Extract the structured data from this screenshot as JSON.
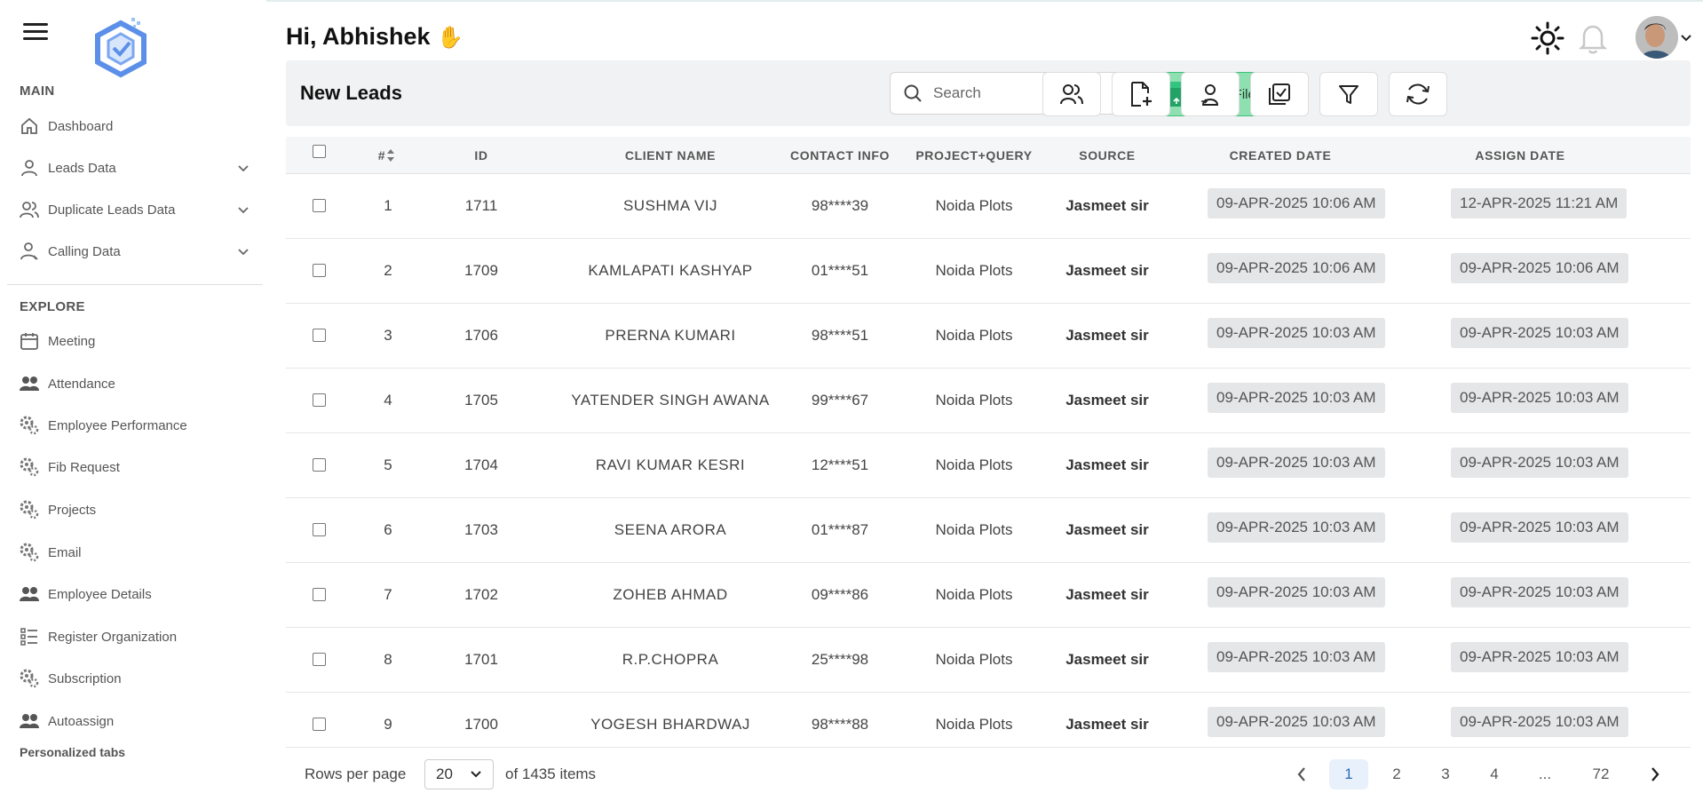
{
  "sidebar": {
    "main_title": "MAIN",
    "main_items": [
      {
        "label": "Dashboard"
      },
      {
        "label": "Leads Data"
      },
      {
        "label": "Duplicate Leads Data"
      },
      {
        "label": "Calling Data"
      }
    ],
    "explore_title": "EXPLORE",
    "explore_items": [
      {
        "label": "Meeting"
      },
      {
        "label": "Attendance"
      },
      {
        "label": "Employee Performance"
      },
      {
        "label": "Fib Request"
      },
      {
        "label": "Projects"
      },
      {
        "label": "Email"
      },
      {
        "label": "Employee Details"
      },
      {
        "label": "Register Organization"
      },
      {
        "label": "Subscription"
      },
      {
        "label": "Autoassign"
      }
    ],
    "personalized": "Personalized tabs"
  },
  "header": {
    "greeting": "Hi, Abhishek",
    "greeting_emoji": "✋"
  },
  "toolbar": {
    "title": "New Leads",
    "search_placeholder": "Search",
    "import_label": "Import File",
    "import_icon": "excel-icon"
  },
  "table": {
    "columns": [
      "#",
      "ID",
      "CLIENT NAME",
      "CONTACT INFO",
      "PROJECT+QUERY",
      "SOURCE",
      "CREATED DATE",
      "ASSIGN DATE"
    ],
    "rows": [
      {
        "n": "1",
        "id": "1711",
        "name": "SUSHMA VIJ",
        "contact": "98****39",
        "project": "Noida Plots",
        "source": "Jasmeet sir",
        "created": "09-APR-2025 10:06 AM",
        "assigned": "12-APR-2025 11:21 AM"
      },
      {
        "n": "2",
        "id": "1709",
        "name": "KAMLAPATI KASHYAP",
        "contact": "01****51",
        "project": "Noida Plots",
        "source": "Jasmeet sir",
        "created": "09-APR-2025 10:06 AM",
        "assigned": "09-APR-2025 10:06 AM"
      },
      {
        "n": "3",
        "id": "1706",
        "name": "PRERNA KUMARI",
        "contact": "98****51",
        "project": "Noida Plots",
        "source": "Jasmeet sir",
        "created": "09-APR-2025 10:03 AM",
        "assigned": "09-APR-2025 10:03 AM"
      },
      {
        "n": "4",
        "id": "1705",
        "name": "YATENDER SINGH AWANA",
        "contact": "99****67",
        "project": "Noida Plots",
        "source": "Jasmeet sir",
        "created": "09-APR-2025 10:03 AM",
        "assigned": "09-APR-2025 10:03 AM"
      },
      {
        "n": "5",
        "id": "1704",
        "name": "RAVI KUMAR KESRI",
        "contact": "12****51",
        "project": "Noida Plots",
        "source": "Jasmeet sir",
        "created": "09-APR-2025 10:03 AM",
        "assigned": "09-APR-2025 10:03 AM"
      },
      {
        "n": "6",
        "id": "1703",
        "name": "SEENA ARORA",
        "contact": "01****87",
        "project": "Noida Plots",
        "source": "Jasmeet sir",
        "created": "09-APR-2025 10:03 AM",
        "assigned": "09-APR-2025 10:03 AM"
      },
      {
        "n": "7",
        "id": "1702",
        "name": "ZOHEB AHMAD",
        "contact": "09****86",
        "project": "Noida Plots",
        "source": "Jasmeet sir",
        "created": "09-APR-2025 10:03 AM",
        "assigned": "09-APR-2025 10:03 AM"
      },
      {
        "n": "8",
        "id": "1701",
        "name": "R.P.CHOPRA",
        "contact": "25****98",
        "project": "Noida Plots",
        "source": "Jasmeet sir",
        "created": "09-APR-2025 10:03 AM",
        "assigned": "09-APR-2025 10:03 AM"
      },
      {
        "n": "9",
        "id": "1700",
        "name": "YOGESH BHARDWAJ",
        "contact": "98****88",
        "project": "Noida Plots",
        "source": "Jasmeet sir",
        "created": "09-APR-2025 10:03 AM",
        "assigned": "09-APR-2025 10:03 AM"
      }
    ]
  },
  "footer": {
    "rows_per_page_label": "Rows per page",
    "rows_per_page_value": "20",
    "items_text": "of 1435 items",
    "pages": [
      "1",
      "2",
      "3",
      "4",
      "...",
      "72"
    ],
    "active_page": "1"
  },
  "colors": {
    "import_bg": "#8fe0b0",
    "active_page_bg": "#e8f1fb",
    "logo_blue": "#5b8fe8"
  }
}
